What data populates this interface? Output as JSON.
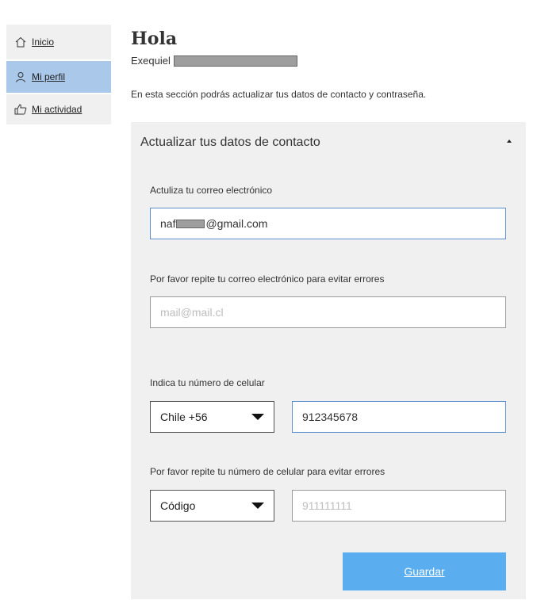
{
  "sidebar": {
    "items": [
      {
        "label": "Inicio",
        "icon": "home-icon"
      },
      {
        "label": "Mi perfil",
        "icon": "person-icon"
      },
      {
        "label": "Mi actividad",
        "icon": "thumbs-up-icon"
      }
    ]
  },
  "header": {
    "greeting": "Hola",
    "user_name": "Exequiel",
    "intro": "En esta sección podrás actualizar tus datos de contacto y contraseña."
  },
  "panel": {
    "title": "Actualizar tus datos de contacto",
    "email_label": "Actuliza tu correo electrónico",
    "email_prefix": "naf",
    "email_suffix": "@gmail.com",
    "email_repeat_label": "Por favor repite tu correo electrónico para evitar errores",
    "email_repeat_placeholder": "mail@mail.cl",
    "phone_label": "Indica tu número de celular",
    "country_code_selected": "Chile +56",
    "phone_value": "912345678",
    "phone_repeat_label": "Por favor repite tu número de celular para evitar errores",
    "country_code_repeat_selected": "Código",
    "phone_repeat_placeholder": "911111111",
    "save_label": "Guardar"
  },
  "colors": {
    "active_sidebar": "#a9c8ea",
    "panel_bg": "#f0f0f0",
    "button_bg": "#5aaef0",
    "focus_border": "#5b8fd1"
  }
}
